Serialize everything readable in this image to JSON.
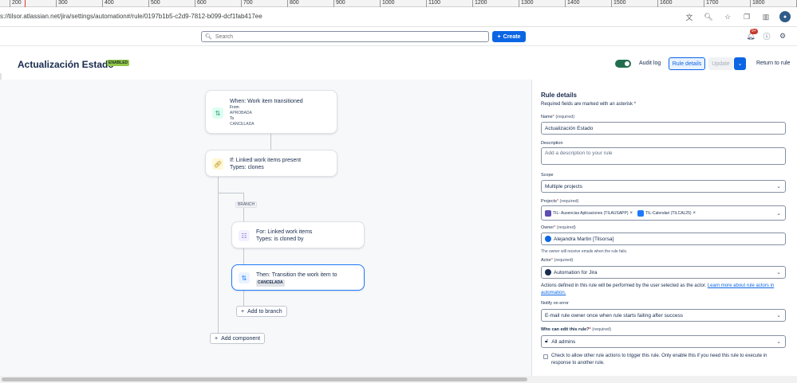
{
  "ruler": {
    "ticks": [
      "200",
      "300",
      "400",
      "500",
      "600",
      "700",
      "800",
      "900",
      "1000",
      "1100",
      "1200",
      "1300",
      "1400",
      "1500",
      "1600",
      "1700",
      "1800",
      "1900"
    ]
  },
  "browser": {
    "url": "s://tilsor.atlassian.net/jira/settings/automation#/rule/0197b1b5-c2d9-7812-b099-dcf1fab417ee",
    "icons": [
      "translate-icon",
      "zoom-icon",
      "star-icon",
      "extensions-icon",
      "sidepanel-icon"
    ]
  },
  "topnav": {
    "search_placeholder": "Search",
    "create_label": "Create",
    "notifications_count": "9+"
  },
  "header": {
    "title": "Actualización Estado",
    "status": "ENABLED",
    "audit_log": "Audit log",
    "rule_details": "Rule details",
    "update": "Update",
    "return": "Return to rule"
  },
  "flow": {
    "trigger": {
      "title": "When: Work item transitioned",
      "from_label": "From",
      "from": "APROBADA",
      "to_label": "To",
      "to": "CANCELADA"
    },
    "condition": {
      "title": "If: Linked work items present",
      "sub": "Types: clones"
    },
    "branch_label": "BRANCH",
    "branch": {
      "title": "For: Linked work items",
      "sub": "Types: is cloned by"
    },
    "action": {
      "title": "Then: Transition the work item to",
      "value": "CANCELADA"
    },
    "add_to_branch": "Add to branch",
    "add_component": "Add component"
  },
  "panel": {
    "title": "Rule details",
    "required_note": "Required fields are marked with an asterisk *",
    "name_label": "Name",
    "required": "(required)",
    "name_value": "Actualización Estado",
    "description_label": "Description",
    "description_placeholder": "Add a description to your rule",
    "scope_label": "Scope",
    "scope_value": "Multiple projects",
    "projects_label": "Projects",
    "projects": [
      "TIL- Ausencias Aplicaciones (TILAUSAPP)",
      "TIL-Calendari (TILCAL25)"
    ],
    "owner_label": "Owner",
    "owner_value": "Alejandra Martin [Tilsorsa]",
    "owner_note": "The owner will receive emails when the rule fails.",
    "actor_label": "Actor",
    "actor_value": "Automation for Jira",
    "actor_note": "Actions defined in this rule will be performed by the user selected as the actor.",
    "actor_link": "Learn more about rule actors in automation.",
    "notify_label": "Notify on error",
    "notify_value": "E-mail rule owner once when rule starts failing after success",
    "edit_label": "Who can edit this rule?",
    "edit_value": "All admins",
    "checkbox_text": "Check to allow other rule actions to trigger this rule. Only enable this if you need this rule to execute in response to another rule."
  }
}
